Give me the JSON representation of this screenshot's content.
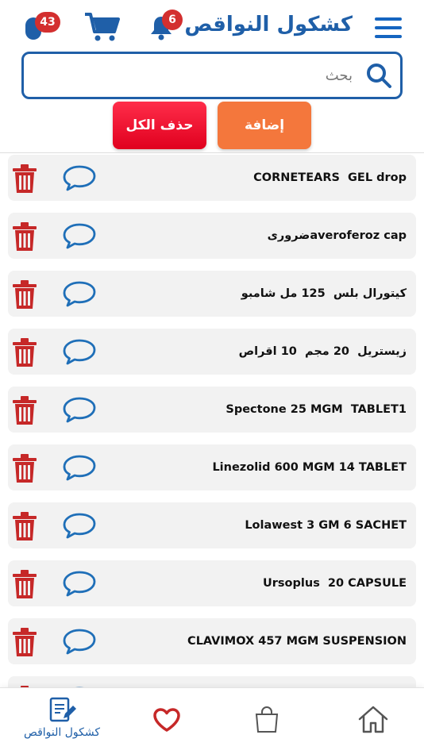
{
  "header": {
    "title": "كشكول النواقص",
    "notifications_count": "6",
    "pills_count": "43",
    "menu_icon": "hamburger-menu-icon",
    "accent_color": "#1f5fa8"
  },
  "search": {
    "placeholder": "بحث",
    "value": ""
  },
  "actions": {
    "add_label": "إضافة",
    "delete_all_label": "حذف الكل",
    "add_color": "#f4773c",
    "delete_all_color": "#ff1a3a"
  },
  "items": [
    {
      "name": "CORNETEARS  GEL drop"
    },
    {
      "name": "ضرورىaveroferoz cap"
    },
    {
      "name": "كيتورال بلس  125 مل شامبو"
    },
    {
      "name": "زيستريل  20 مجم  10 اقراص"
    },
    {
      "name": "Spectone 25 MGM  TABLET1"
    },
    {
      "name": "Linezolid 600 MGM 14 TABLET"
    },
    {
      "name": "Lolawest 3 GM 6 SACHET"
    },
    {
      "name": "Ursoplus  20 CAPSULE"
    },
    {
      "name": "CLAVIMOX 457 MGM SUSPENSION"
    },
    {
      "name": ""
    }
  ],
  "bottom_nav": {
    "shortages_label": "كشكول النواقص",
    "trash_color": "#c62828",
    "chat_color": "#1f6fb8"
  }
}
